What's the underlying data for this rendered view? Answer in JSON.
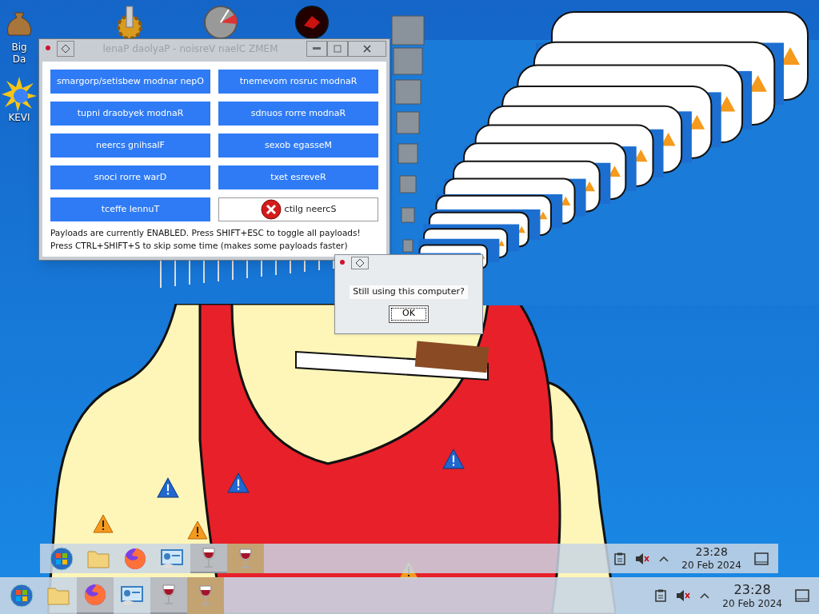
{
  "desktop_icons": [
    {
      "kind": "money",
      "lines": [
        "Big",
        "Da"
      ]
    },
    {
      "kind": "sun",
      "lines": [
        "KEVI"
      ]
    },
    {
      "kind": "gear"
    },
    {
      "kind": "gauge"
    },
    {
      "kind": "dark"
    }
  ],
  "payload_panel": {
    "title": "lenaP daolyaP - noisreV naelC ZMEM",
    "active": false,
    "payloads": [
      {
        "label": "smargorp/setisbew modnar nepO",
        "on": true
      },
      {
        "label": "tnemevom rosruc modnaR",
        "on": true
      },
      {
        "label": "tupni draobyek modnaR",
        "on": true
      },
      {
        "label": "sdnuos rorre modnaR",
        "on": true
      },
      {
        "label": "neercs gnihsalF",
        "on": true
      },
      {
        "label": "sexob egasseM",
        "on": true
      },
      {
        "label": "snoci rorre warD",
        "on": true
      },
      {
        "label": "txet esreveR",
        "on": true
      },
      {
        "label": "tceffe lennuT",
        "on": true
      },
      {
        "label": "ctilg neercS",
        "on": false
      }
    ],
    "status_lines": [
      "Payloads are currently ENABLED. Press SHIFT+ESC to toggle all payloads!",
      "Press CTRL+SHIFT+S to skip some time (makes some payloads faster)"
    ]
  },
  "dialog": {
    "message": "Still using this computer?",
    "button": "OK"
  },
  "taskbars": [
    {
      "apps": [
        {
          "kind": "start",
          "highlighted": false,
          "selected": false
        },
        {
          "kind": "folder",
          "highlighted": false,
          "selected": false
        },
        {
          "kind": "browser",
          "highlighted": false,
          "selected": false
        },
        {
          "kind": "control",
          "highlighted": false,
          "selected": false
        },
        {
          "kind": "wine",
          "highlighted": true,
          "selected": false
        },
        {
          "kind": "wine",
          "highlighted": false,
          "selected": true
        }
      ],
      "time": "23:28",
      "date": "20 Feb 2024"
    },
    {
      "apps": [
        {
          "kind": "start",
          "highlighted": false,
          "selected": false
        },
        {
          "kind": "folder",
          "highlighted": false,
          "selected": false
        },
        {
          "kind": "browser",
          "highlighted": true,
          "selected": false
        },
        {
          "kind": "control",
          "highlighted": false,
          "selected": false
        },
        {
          "kind": "wine",
          "highlighted": true,
          "selected": false
        },
        {
          "kind": "wine",
          "highlighted": false,
          "selected": true
        }
      ],
      "time": "23:28",
      "date": "20 Feb 2024"
    }
  ]
}
